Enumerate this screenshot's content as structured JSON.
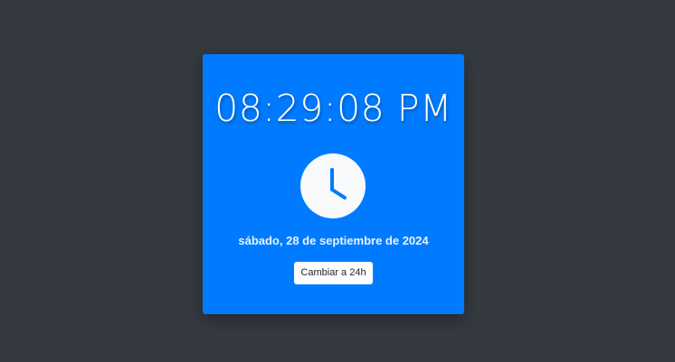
{
  "clock": {
    "time": "08:29:08 PM",
    "date": "sábado, 28 de septiembre de 2024",
    "icon": "clock-icon",
    "toggle_label": "Cambiar a 24h"
  },
  "colors": {
    "background": "#343a40",
    "card": "#007bff",
    "icon_circle": "#f8f9fa",
    "icon_hands": "#007bff"
  }
}
